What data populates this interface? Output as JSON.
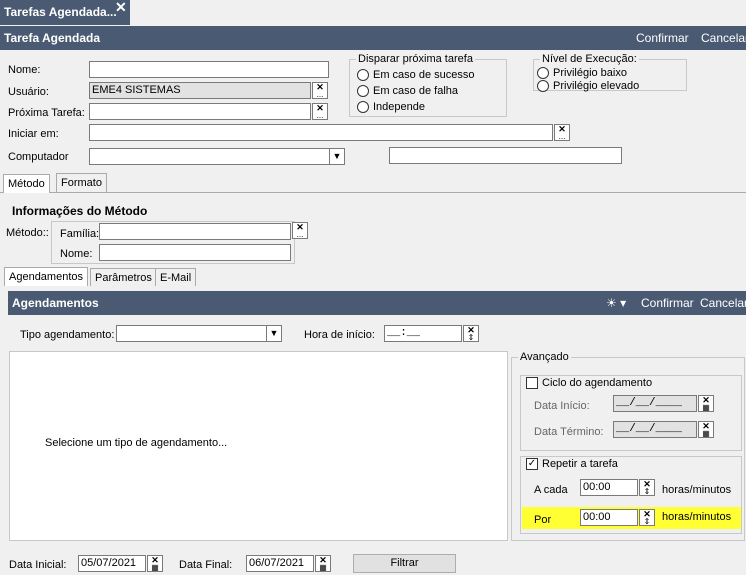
{
  "window_tab": {
    "title": "Tarefas Agendada...",
    "close_glyph": "✕"
  },
  "header": {
    "title": "Tarefa Agendada",
    "confirm": "Confirmar",
    "cancel": "Cancelar"
  },
  "form": {
    "nome_label": "Nome:",
    "nome_value": "",
    "usuario_label": "Usuário:",
    "usuario_value": "EME4 SISTEMAS",
    "proxima_label": "Próxima Tarefa:",
    "proxima_value": "",
    "iniciar_label": "Iniciar em:",
    "iniciar_value": "",
    "computador_label": "Computador",
    "computador_value": "",
    "computador_extra": ""
  },
  "disparar": {
    "legend": "Disparar próxima tarefa",
    "opt1": "Em caso de sucesso",
    "opt2": "Em caso de falha",
    "opt3": "Independe"
  },
  "nivel": {
    "legend": "Nível de Execução:",
    "opt1": "Privilégio baixo",
    "opt2": "Privilégio elevado"
  },
  "tabs_top": {
    "metodo": "Método",
    "formato": "Formato"
  },
  "metodo": {
    "title": "Informações do Método",
    "label": "Método::",
    "familia_label": "Família:",
    "familia_value": "",
    "nome_label": "Nome:",
    "nome_value": ""
  },
  "tabs_sub": {
    "agendamentos": "Agendamentos",
    "parametros": "Parâmetros",
    "email": "E-Mail"
  },
  "agend": {
    "title": "Agendamentos",
    "confirm": "Confirmar",
    "cancel": "Cancelar",
    "sun_icon": "sun-icon",
    "tipo_label": "Tipo agendamento:",
    "tipo_value": "",
    "hora_label": "Hora de início:",
    "hora_value": "__:__",
    "empty_message": "Selecione um tipo de agendamento..."
  },
  "avancado": {
    "legend": "Avançado",
    "ciclo_label": "Ciclo do agendamento",
    "ciclo_checked": false,
    "data_inicio_label": "Data Início:",
    "data_inicio_value": "__/__/____",
    "data_termino_label": "Data Término:",
    "data_termino_value": "__/__/____",
    "repetir_label": "Repetir a tarefa",
    "repetir_checked": true,
    "acada_label": "A cada",
    "acada_value": "00:00",
    "acada_unit": "horas/minutos",
    "por_label": "Por",
    "por_value": "00:00",
    "por_unit": "horas/minutos",
    "check_glyph": "✓"
  },
  "footer": {
    "data_inicial_label": "Data Inicial:",
    "data_inicial_value": "05/07/2021",
    "data_final_label": "Data Final:",
    "data_final_value": "06/07/2021",
    "filtrar": "Filtrar"
  },
  "glyphs": {
    "x": "✕",
    "dots": "...",
    "down": "▼",
    "spin": "⇕",
    "cal": "▦"
  },
  "colors": {
    "header": "#4a5a72",
    "highlight": "#ffff33"
  }
}
